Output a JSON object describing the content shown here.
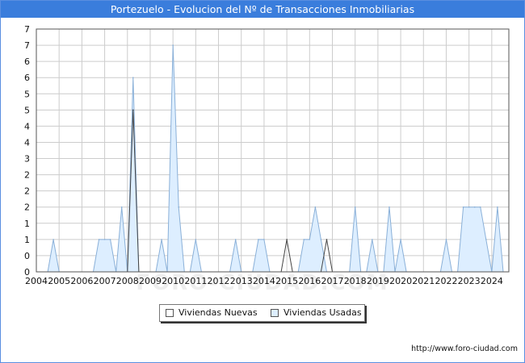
{
  "title": "Portezuelo - Evolucion del Nº de Transacciones Inmobiliarias",
  "watermark": "FORO-CIUDAD.COM",
  "url": "http://www.foro-ciudad.com",
  "legend": {
    "nuevas": "Viviendas Nuevas",
    "usadas": "Viviendas Usadas"
  },
  "colors": {
    "title_bg": "#3a7ddc",
    "usadas_fill": "#ddeeff",
    "usadas_line": "#8ab0d8",
    "nuevas_line": "#444444",
    "grid": "#cccccc"
  },
  "chart_data": {
    "type": "area",
    "title": "Portezuelo - Evolucion del Nº de Transacciones Inmobiliarias",
    "xlabel": "",
    "ylabel": "",
    "xlim": [
      2004,
      2024.75
    ],
    "ylim": [
      0,
      7.5
    ],
    "x_tick_labels": [
      "2004",
      "2005",
      "2006",
      "2007",
      "2008",
      "2009",
      "2010",
      "2011",
      "2012",
      "2013",
      "2014",
      "2015",
      "2016",
      "2017",
      "2018",
      "2019",
      "2020",
      "2021",
      "2022",
      "2023",
      "2024"
    ],
    "y_tick_values": [
      0,
      0.5,
      1,
      1.5,
      2,
      2.5,
      3,
      3.5,
      4,
      4.5,
      5,
      5.5,
      6,
      6.5,
      7,
      7.5
    ],
    "y_tick_labels": [
      "0",
      "0",
      "1",
      "1",
      "2",
      "2",
      "2",
      "3",
      "4",
      "4",
      "5",
      "5",
      "6",
      "6",
      "7",
      "7"
    ],
    "grid": true,
    "legend_position": "bottom",
    "series": [
      {
        "name": "Viviendas Usadas",
        "x": [
          2004.5,
          2004.75,
          2005,
          2006.5,
          2006.75,
          2007,
          2007.25,
          2007.5,
          2007.75,
          2008,
          2008.25,
          2008.5,
          2009.25,
          2009.5,
          2009.75,
          2010,
          2010.25,
          2010.5,
          2010.75,
          2011,
          2011.25,
          2012.5,
          2012.75,
          2013,
          2013.5,
          2013.75,
          2014,
          2014.25,
          2015.5,
          2015.75,
          2016,
          2016.25,
          2016.5,
          2016.75,
          2017.75,
          2018,
          2018.25,
          2018.5,
          2018.75,
          2019,
          2019.25,
          2019.5,
          2019.75,
          2020,
          2020.25,
          2020.5,
          2021.75,
          2022,
          2022.25,
          2022.5,
          2022.75,
          2023,
          2023.25,
          2023.5,
          2023.75,
          2024,
          2024.25,
          2024.5
        ],
        "values": [
          0,
          1,
          0,
          0,
          1,
          1,
          1,
          0,
          2,
          0,
          6,
          0,
          0,
          1,
          0,
          7,
          2,
          0,
          0,
          1,
          0,
          0,
          1,
          0,
          0,
          1,
          1,
          0,
          0,
          1,
          1,
          2,
          1,
          0,
          0,
          2,
          0,
          0,
          1,
          0,
          0,
          2,
          0,
          1,
          0,
          0,
          0,
          1,
          0,
          0,
          2,
          2,
          2,
          2,
          1,
          0,
          2,
          0
        ]
      },
      {
        "name": "Viviendas Nuevas",
        "x": [
          2008.0,
          2008.25,
          2008.5,
          2014.75,
          2015,
          2015.25,
          2016.5,
          2016.75,
          2017
        ],
        "values": [
          0,
          5,
          0,
          0,
          1,
          0,
          0,
          1,
          0
        ]
      }
    ]
  }
}
